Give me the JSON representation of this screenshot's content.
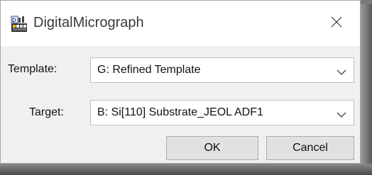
{
  "window": {
    "title": "DigitalMicrograph",
    "icon": "digitalmicrograph-app-icon",
    "close_icon": "close-icon"
  },
  "form": {
    "template": {
      "label": "Template:",
      "value": "G: Refined Template"
    },
    "target": {
      "label": "Target:",
      "value": "B: Si[110] Substrate_JEOL ADF1"
    }
  },
  "buttons": {
    "ok": "OK",
    "cancel": "Cancel"
  },
  "colors": {
    "client_bg": "#f0f0f0",
    "button_bg": "#e1e1e1",
    "titlebar_bg": "#ffffff"
  }
}
